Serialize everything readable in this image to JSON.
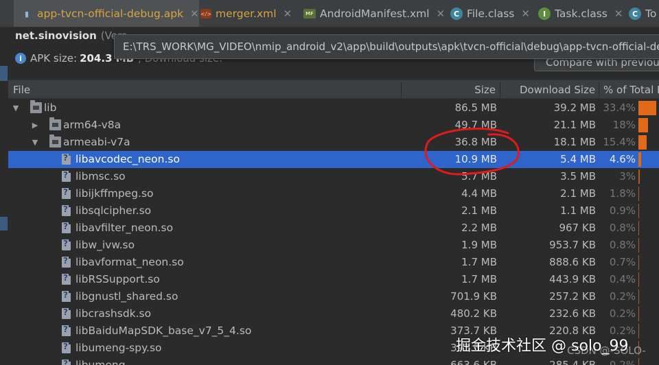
{
  "tabs": [
    {
      "label": "app-tvcn-official-debug.apk",
      "icon": "apk-file-icon",
      "active": true
    },
    {
      "label": "merger.xml",
      "icon": "xml-file-icon",
      "active": false
    },
    {
      "label": "AndroidManifest.xml",
      "icon": "manifest-file-icon",
      "active": false
    },
    {
      "label": "File.class",
      "icon": "class-file-icon",
      "active": false
    },
    {
      "label": "Task.class",
      "icon": "interface-file-icon",
      "active": false
    },
    {
      "label": "To",
      "icon": "class-file-icon",
      "active": false
    }
  ],
  "header": {
    "package": "net.sinovision",
    "version_text": "(Vers",
    "apk_size_label": "APK size:",
    "apk_size_value": "204.3 MB",
    "download_size_text": ", Download size:",
    "compare_button": "Compare with previous",
    "tooltip": "E:\\TRS_WORK\\MG_VIDEO\\nmip_android_v2\\app\\build\\outputs\\apk\\tvcn-official\\debug\\app-tvcn-official-debug.apk"
  },
  "columns": {
    "file": "File",
    "size": "Size",
    "download_size": "Download Size",
    "percent": "% of Total D"
  },
  "rows": [
    {
      "name": "lib",
      "level": 0,
      "type": "folder",
      "expanded": true,
      "size": "86.5 MB",
      "download": "39.2 MB",
      "percent": "33.4%",
      "fraction": 0.334,
      "selected": false
    },
    {
      "name": "arm64-v8a",
      "level": 1,
      "type": "folder",
      "expanded": false,
      "size": "49.7 MB",
      "download": "21.1 MB",
      "percent": "18%",
      "fraction": 0.18,
      "selected": false
    },
    {
      "name": "armeabi-v7a",
      "level": 1,
      "type": "folder",
      "expanded": true,
      "size": "36.8 MB",
      "download": "18.1 MB",
      "percent": "15.4%",
      "fraction": 0.154,
      "selected": false
    },
    {
      "name": "libavcodec_neon.so",
      "level": 2,
      "type": "file",
      "size": "10.9 MB",
      "download": "5.4 MB",
      "percent": "4.6%",
      "fraction": 0.046,
      "selected": true
    },
    {
      "name": "libmsc.so",
      "level": 2,
      "type": "file",
      "size": "5.7 MB",
      "download": "3.5 MB",
      "percent": "3%",
      "fraction": 0.03,
      "selected": false
    },
    {
      "name": "libijkffmpeg.so",
      "level": 2,
      "type": "file",
      "size": "4.4 MB",
      "download": "2.1 MB",
      "percent": "1.8%",
      "fraction": 0.018,
      "selected": false
    },
    {
      "name": "libsqlcipher.so",
      "level": 2,
      "type": "file",
      "size": "2.1 MB",
      "download": "1.1 MB",
      "percent": "0.9%",
      "fraction": 0.009,
      "selected": false
    },
    {
      "name": "libavfilter_neon.so",
      "level": 2,
      "type": "file",
      "size": "2.2 MB",
      "download": "967 KB",
      "percent": "0.8%",
      "fraction": 0.008,
      "selected": false
    },
    {
      "name": "libw_ivw.so",
      "level": 2,
      "type": "file",
      "size": "1.9 MB",
      "download": "953.7 KB",
      "percent": "0.8%",
      "fraction": 0.008,
      "selected": false
    },
    {
      "name": "libavformat_neon.so",
      "level": 2,
      "type": "file",
      "size": "1.7 MB",
      "download": "888.6 KB",
      "percent": "0.7%",
      "fraction": 0.007,
      "selected": false
    },
    {
      "name": "libRSSupport.so",
      "level": 2,
      "type": "file",
      "size": "1.7 MB",
      "download": "443.9 KB",
      "percent": "0.4%",
      "fraction": 0.004,
      "selected": false
    },
    {
      "name": "libgnustl_shared.so",
      "level": 2,
      "type": "file",
      "size": "701.9 KB",
      "download": "257.2 KB",
      "percent": "0.2%",
      "fraction": 0.002,
      "selected": false
    },
    {
      "name": "libcrashsdk.so",
      "level": 2,
      "type": "file",
      "size": "480.2 KB",
      "download": "232.6 KB",
      "percent": "0.2%",
      "fraction": 0.002,
      "selected": false
    },
    {
      "name": "libBaiduMapSDK_base_v7_5_4.so",
      "level": 2,
      "type": "file",
      "size": "373.7 KB",
      "download": "220.8 KB",
      "percent": "0.2%",
      "fraction": 0.002,
      "selected": false
    },
    {
      "name": "libumeng-spy.so",
      "level": 2,
      "type": "file",
      "size": "393.3 KB",
      "download": "",
      "percent": "",
      "fraction": 0.001,
      "selected": false
    },
    {
      "name": "libumeng...",
      "level": 2,
      "type": "file",
      "size": "663.6 KB",
      "download": "285.4 KB",
      "percent": "0.2%",
      "fraction": 0.002,
      "selected": false
    }
  ],
  "watermark": "掘金技术社区 @ solo_99",
  "csdn_mark": "CSDN @-SOLO-",
  "colors": {
    "accent_bar": "#e06a1a",
    "selection": "#2f65ca",
    "annotation": "#e01b1b"
  }
}
